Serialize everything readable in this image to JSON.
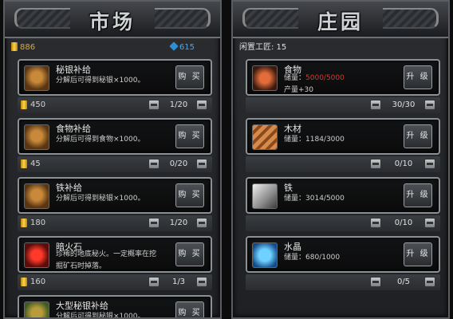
{
  "market": {
    "title": "市场",
    "gold": "886",
    "crystal": "615",
    "items": [
      {
        "name": "秘银补给",
        "desc": "分解后可得到秘银×1000。",
        "desc2": "",
        "button": "购 买",
        "cost": "450",
        "count": "1/20",
        "icon": "chest-icon"
      },
      {
        "name": "食物补给",
        "desc": "分解后可得到食物×1000。",
        "desc2": "",
        "button": "购 买",
        "cost": "45",
        "count": "0/20",
        "icon": "chest-icon"
      },
      {
        "name": "铁补给",
        "desc": "分解后可得到秘银×1000。",
        "desc2": "",
        "button": "购 买",
        "cost": "180",
        "count": "1/20",
        "icon": "chest-icon"
      },
      {
        "name": "暗火石",
        "desc": "珍稀的地底秘火。一定概率在挖",
        "desc2": "掘矿石时掉落。",
        "button": "购 买",
        "cost": "160",
        "count": "1/3",
        "icon": "fire-stone-icon"
      },
      {
        "name": "大型秘银补给",
        "desc": "分解后可得到秘银×1000。",
        "desc2": "",
        "button": "购 买",
        "cost": "",
        "count": "",
        "icon": "chest-icon"
      }
    ]
  },
  "manor": {
    "title": "庄园",
    "idle_label": "闲置工匠: 15",
    "items": [
      {
        "name": "食物",
        "desc_prefix": "储量：",
        "desc_value": "5000/5000",
        "desc2": "产量+30",
        "button": "升 级",
        "count": "30/30",
        "icon": "meat-icon"
      },
      {
        "name": "木材",
        "desc_prefix": "储量：",
        "desc_value": "1184/3000",
        "desc2": "",
        "button": "升 级",
        "count": "0/10",
        "icon": "wood-icon"
      },
      {
        "name": "铁",
        "desc_prefix": "储量：",
        "desc_value": "3014/5000",
        "desc2": "",
        "button": "升 级",
        "count": "0/10",
        "icon": "iron-icon"
      },
      {
        "name": "水晶",
        "desc_prefix": "储量：",
        "desc_value": "680/1000",
        "desc2": "",
        "button": "升 级",
        "count": "0/5",
        "icon": "crystal-icon"
      }
    ]
  }
}
